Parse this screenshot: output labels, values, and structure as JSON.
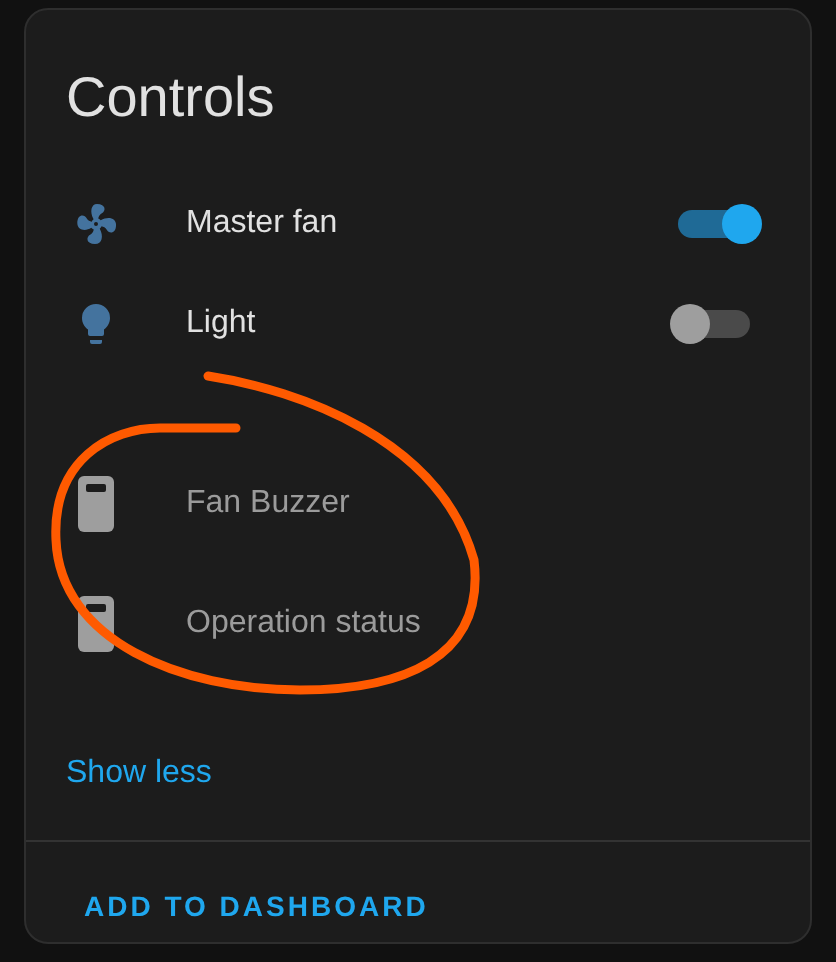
{
  "card": {
    "title": "Controls",
    "entities": [
      {
        "name": "Master fan",
        "kind": "toggle",
        "on": true,
        "disabled": false
      },
      {
        "name": "Light",
        "kind": "toggle",
        "on": false,
        "disabled": false
      },
      {
        "name": "Fan Buzzer",
        "kind": "unavailable",
        "disabled": true
      },
      {
        "name": "Operation status",
        "kind": "unavailable",
        "disabled": true
      }
    ],
    "show_less": "Show less",
    "action": "ADD TO DASHBOARD"
  }
}
